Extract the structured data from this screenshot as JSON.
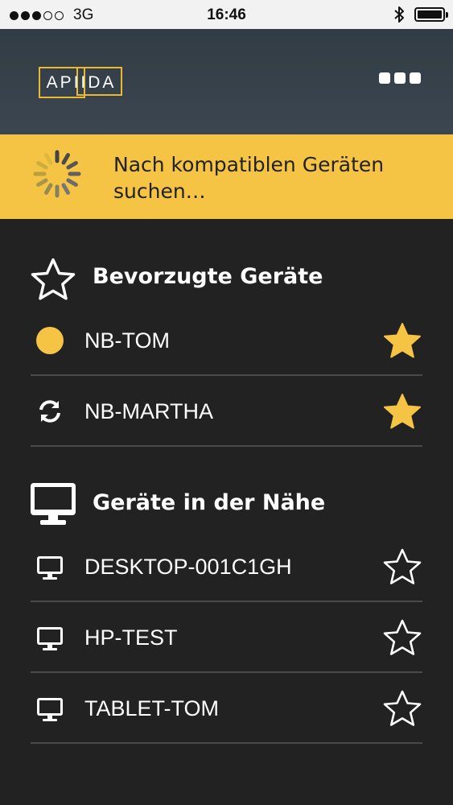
{
  "status_bar": {
    "signal_dots_filled": 3,
    "signal_dots_total": 5,
    "carrier": "3G",
    "time": "16:46",
    "bluetooth_icon": "bluetooth-icon",
    "battery_level": 1.0
  },
  "header": {
    "logo_text": "APIIDA",
    "menu_icon": "more-dots-icon",
    "accent_color": "#f6c444"
  },
  "banner": {
    "text": "Nach kompatiblen Geräten suchen…",
    "icon": "spinner-icon"
  },
  "favorites": {
    "title": "Bevorzugte Geräte",
    "icon": "star-outline-icon",
    "devices": [
      {
        "name": "NB-TOM",
        "status_icon": "online-dot-icon",
        "favorite": true
      },
      {
        "name": "NB-MARTHA",
        "status_icon": "sync-icon",
        "favorite": true
      }
    ]
  },
  "nearby": {
    "title": "Geräte in der Nähe",
    "icon": "monitor-icon",
    "devices": [
      {
        "name": "DESKTOP-001C1GH",
        "status_icon": "monitor-icon",
        "favorite": false
      },
      {
        "name": "HP-TEST",
        "status_icon": "monitor-icon",
        "favorite": false
      },
      {
        "name": "TABLET-TOM",
        "status_icon": "monitor-icon",
        "favorite": false
      }
    ]
  }
}
